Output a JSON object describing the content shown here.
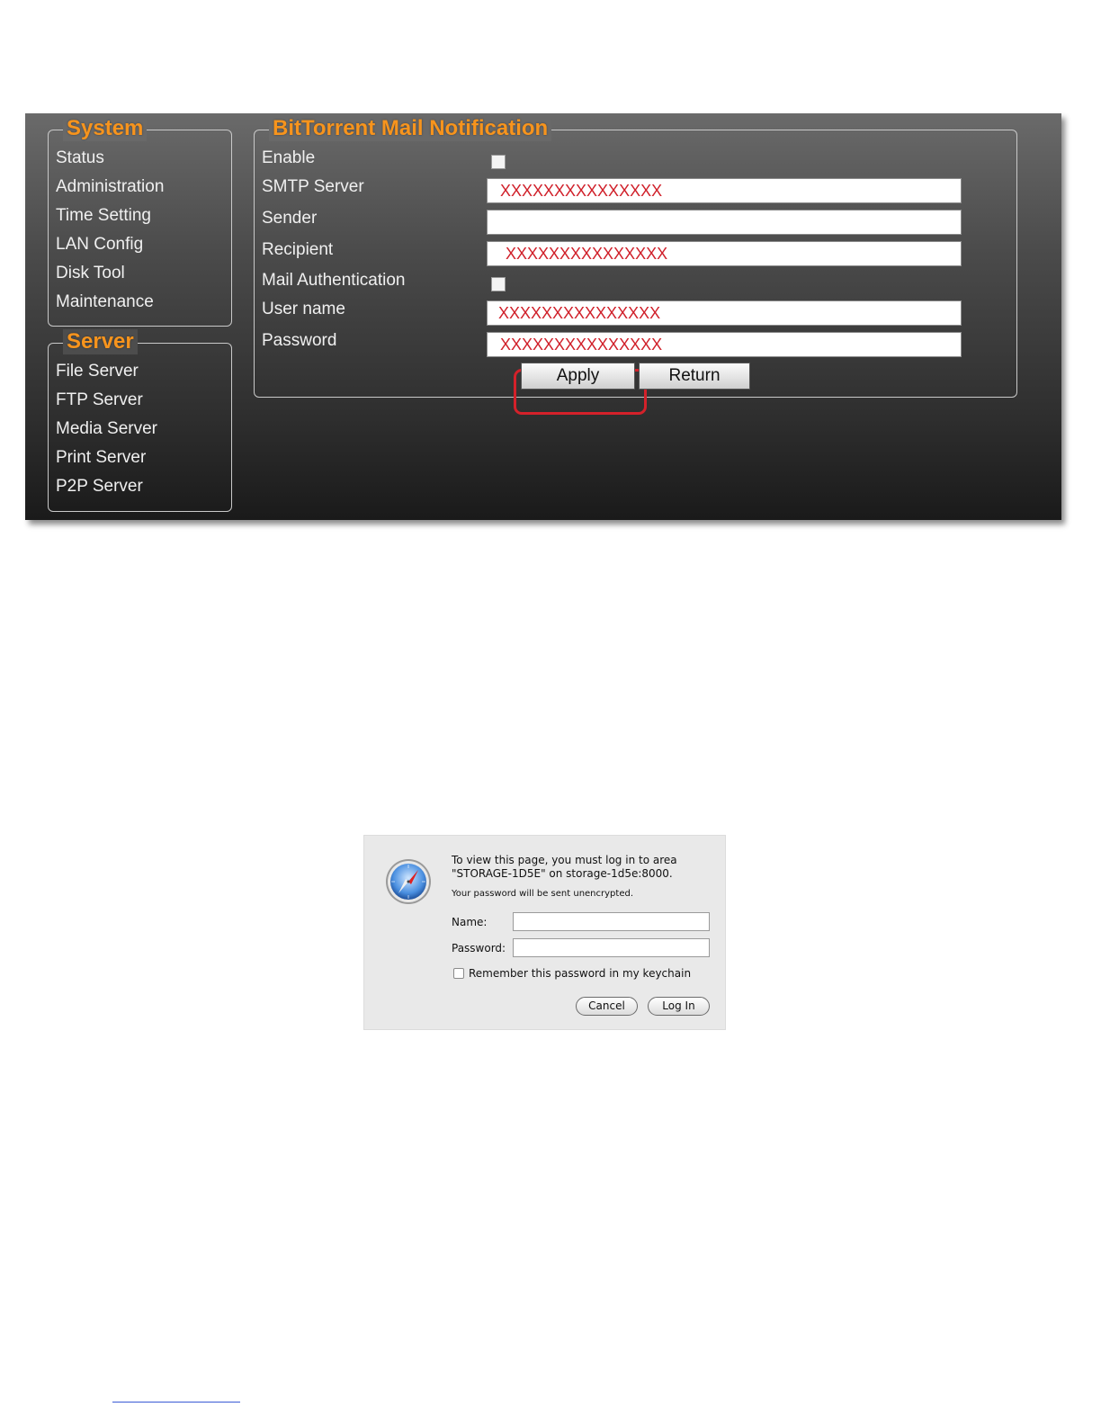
{
  "nas": {
    "system_legend": "System",
    "system_items": [
      "Status",
      "Administration",
      "Time Setting",
      "LAN Config",
      "Disk Tool",
      "Maintenance"
    ],
    "server_legend": "Server",
    "server_items": [
      "File Server",
      "FTP Server",
      "Media Server",
      "Print Server",
      "P2P Server"
    ],
    "form_legend": "BitTorrent Mail Notification",
    "fields": {
      "enable_label": "Enable",
      "smtp_label": "SMTP Server",
      "smtp_value": "XXXXXXXXXXXXXXX",
      "sender_label": "Sender",
      "sender_value": "",
      "recipient_label": "Recipient",
      "recipient_value": "XXXXXXXXXXXXXXX",
      "mail_auth_label": "Mail Authentication",
      "username_label": "User name",
      "username_value": "XXXXXXXXXXXXXXX",
      "password_label": "Password",
      "password_value": "XXXXXXXXXXXXXXX"
    },
    "apply_label": "Apply",
    "return_label": "Return",
    "colors": {
      "accent_orange": "#f7941d",
      "redacted_red": "#d0202a",
      "highlight_red": "#d4212a"
    }
  },
  "dialog": {
    "icon": "safari-compass-icon",
    "message_line1": "To view this page, you must log in to area",
    "message_line2": "\"STORAGE-1D5E\" on storage-1d5e:8000.",
    "warning": "Your password will be sent unencrypted.",
    "name_label": "Name:",
    "name_value": "",
    "password_label": "Password:",
    "password_value": "",
    "remember_label": "Remember this password in my keychain",
    "cancel_label": "Cancel",
    "login_label": "Log In"
  }
}
